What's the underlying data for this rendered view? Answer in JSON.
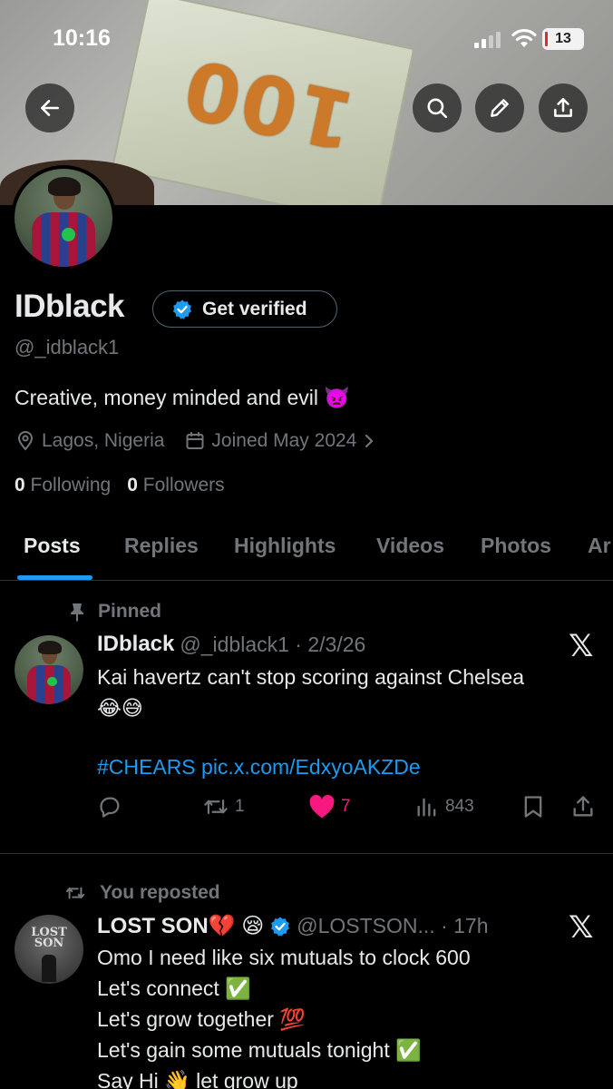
{
  "status_bar": {
    "time": "10:16",
    "battery": "13"
  },
  "banner": {
    "bill_text": "100"
  },
  "profile": {
    "display_name": "IDblack",
    "get_verified_label": "Get verified",
    "handle": "@_idblack1",
    "bio": "Creative, money minded and evil 👿",
    "location": "Lagos, Nigeria",
    "joined": "Joined May 2024",
    "following_count": "0",
    "following_label": "Following",
    "followers_count": "0",
    "followers_label": "Followers"
  },
  "tabs": [
    {
      "label": "Posts",
      "active": true
    },
    {
      "label": "Replies"
    },
    {
      "label": "Highlights"
    },
    {
      "label": "Videos"
    },
    {
      "label": "Photos"
    },
    {
      "label": "Ar"
    }
  ],
  "posts": [
    {
      "context": "Pinned",
      "author": "IDblack",
      "meta": "@_idblack1 · 2/3/26",
      "text_line1": "Kai havertz can't stop scoring against Chelsea",
      "text_line2": "😂😅",
      "link": "#CHEARS pic.x.com/EdxyoAKZDe",
      "reposts": "1",
      "likes": "7",
      "views": "843"
    },
    {
      "context": "You reposted",
      "author": "LOST SON💔 😪",
      "meta": "@LOSTSON... · 17h",
      "avatar_text": "LOST SON",
      "lines": [
        "Omo I need like six mutuals to clock 600",
        "Let's connect ✅",
        "Let's grow together 💯",
        "Let's gain some mutuals tonight ✅",
        "Say Hi 👋 let grow up"
      ]
    }
  ],
  "colors": {
    "accent": "#1d9bf0",
    "like": "#f91880",
    "muted": "#71767b",
    "text": "#e7e9ea",
    "background": "#000000"
  }
}
